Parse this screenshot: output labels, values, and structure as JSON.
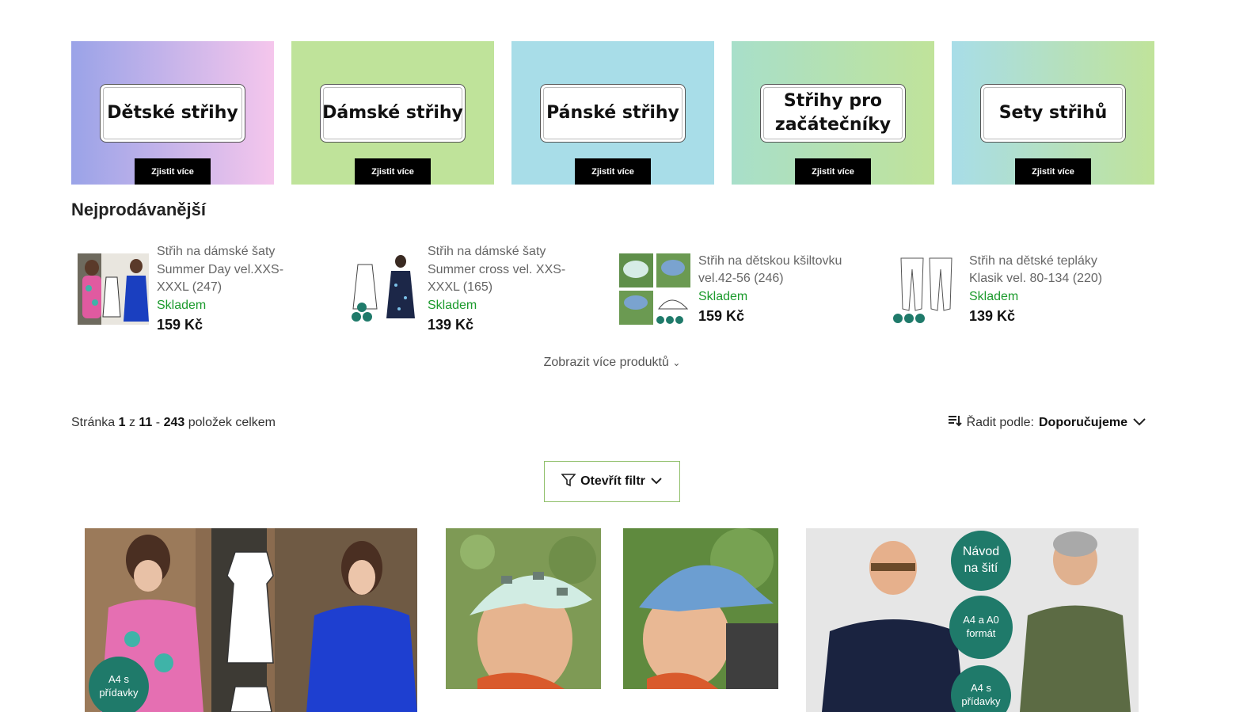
{
  "categories": [
    {
      "title": "Dětské střihy",
      "cta": "Zjistit více",
      "bg": "linear-gradient(90deg,#9aa3e8,#f5c6ec)"
    },
    {
      "title": "Dámské střihy",
      "cta": "Zjistit více",
      "bg": "#bfe39a"
    },
    {
      "title": "Pánské střihy",
      "cta": "Zjistit více",
      "bg": "#a8dde8"
    },
    {
      "title": "Střihy pro začátečníky",
      "cta": "Zjistit více",
      "bg": "linear-gradient(90deg,#a8dfca,#c0e39a)"
    },
    {
      "title": "Sety střihů",
      "cta": "Zjistit více",
      "bg": "linear-gradient(90deg,#a8dde8,#c0e39a)"
    }
  ],
  "bestsellers": {
    "title": "Nejprodávanější",
    "items": [
      {
        "name": "Střih na dámské šaty Summer Day vel.XXS-XXXL (247)",
        "stock": "Skladem",
        "price": "159 Kč"
      },
      {
        "name": "Střih na dámské šaty Summer cross vel. XXS-XXXL (165)",
        "stock": "Skladem",
        "price": "139 Kč"
      },
      {
        "name": "Střih na dětskou kšiltovku vel.42-56 (246)",
        "stock": "Skladem",
        "price": "159 Kč"
      },
      {
        "name": "Střih na dětské tepláky Klasik vel. 80-134 (220)",
        "stock": "Skladem",
        "price": "139 Kč"
      }
    ],
    "show_more": "Zobrazit více produktů"
  },
  "listing": {
    "paging": {
      "prefix": "Stránka",
      "page": "1",
      "of": "z",
      "total_pages": "11",
      "dash": "-",
      "count": "243",
      "suffix": "položek celkem"
    },
    "sort": {
      "label": "Řadit podle:",
      "value": "Doporučujeme"
    },
    "filter_label": "Otevřít filtr"
  },
  "badges": {
    "p1": "A4 s přídavky",
    "p4_a": "Návod na šití",
    "p4_b": "A4 a A0 formát",
    "p4_c": "A4 s přídavky"
  }
}
